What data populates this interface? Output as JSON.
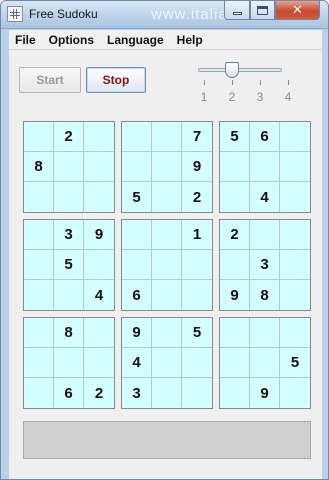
{
  "window": {
    "title": "Free Sudoku",
    "watermark": "www.italiasw.com"
  },
  "menu": [
    "File",
    "Options",
    "Language",
    "Help"
  ],
  "controls": {
    "start_label": "Start",
    "stop_label": "Stop",
    "difficulty": {
      "ticks": [
        "1",
        "2",
        "3",
        "4"
      ],
      "value": 2
    }
  },
  "grid": [
    [
      "",
      "2",
      "",
      "",
      "",
      "7",
      "5",
      "6",
      ""
    ],
    [
      "8",
      "",
      "",
      "",
      "",
      "9",
      "",
      "",
      ""
    ],
    [
      "",
      "",
      "",
      "5",
      "",
      "2",
      "",
      "4",
      ""
    ],
    [
      "",
      "3",
      "9",
      "",
      "",
      "1",
      "2",
      "",
      ""
    ],
    [
      "",
      "5",
      "",
      "",
      "",
      "",
      "",
      "3",
      ""
    ],
    [
      "",
      "",
      "4",
      "6",
      "",
      "",
      "9",
      "8",
      ""
    ],
    [
      "",
      "8",
      "",
      "9",
      "",
      "5",
      "",
      "",
      ""
    ],
    [
      "",
      "",
      "",
      "4",
      "",
      "",
      "",
      "",
      "5"
    ],
    [
      "",
      "6",
      "2",
      "3",
      "",
      "",
      "",
      "9",
      ""
    ]
  ],
  "colors": {
    "cell_background": "#d4ffff",
    "stop_text": "#8b1010",
    "disabled_text": "#9a9a9a"
  }
}
